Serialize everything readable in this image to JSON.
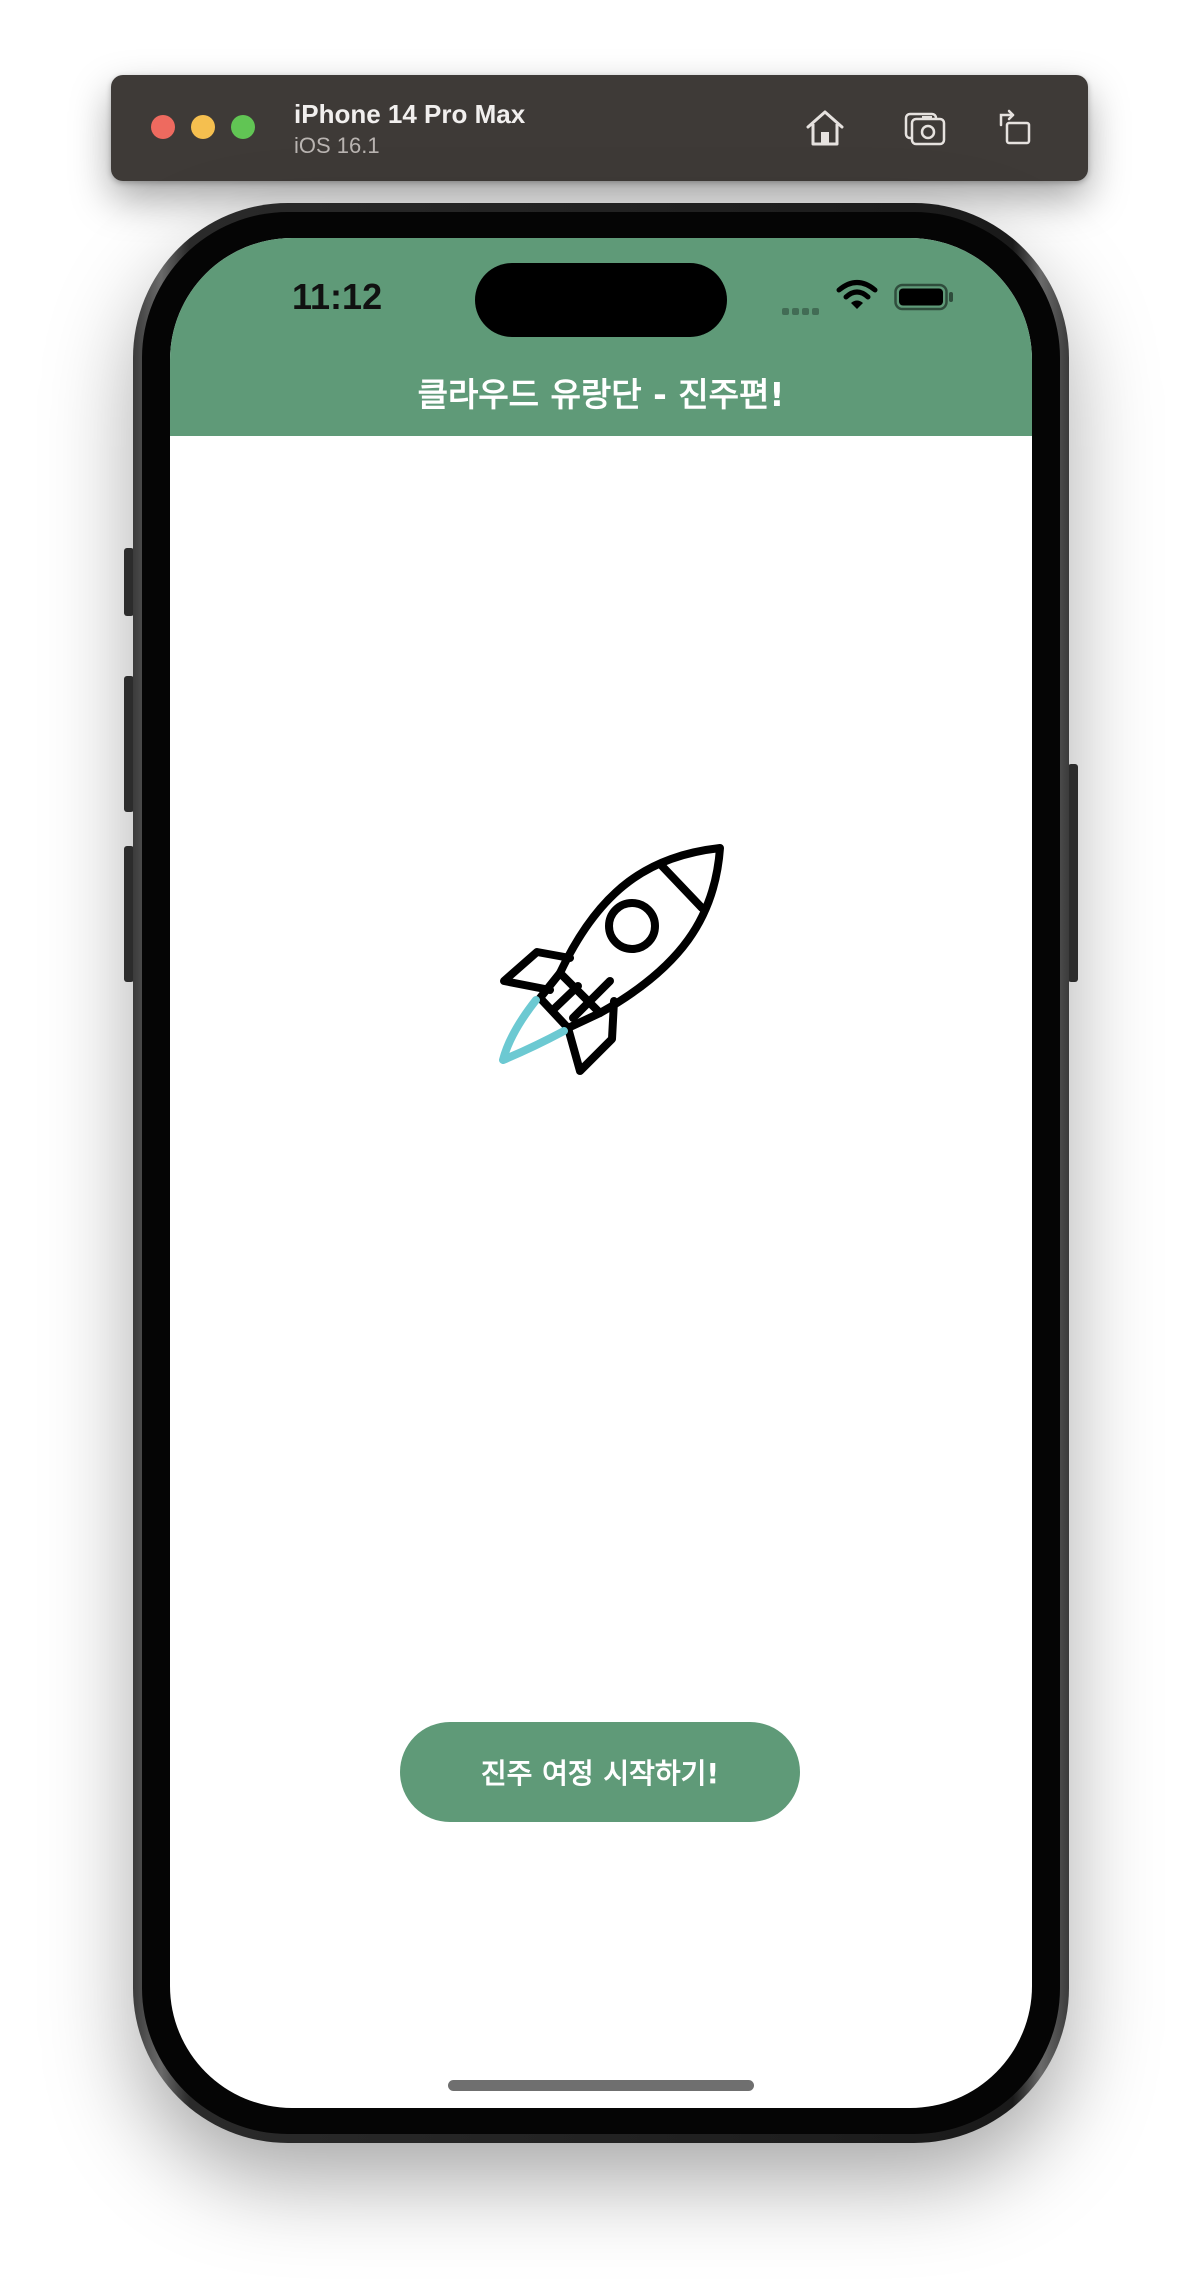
{
  "simulator": {
    "device_name": "iPhone 14 Pro Max",
    "os_version": "iOS 16.1",
    "icons": [
      "home-icon",
      "screenshot-icon",
      "rotate-icon"
    ]
  },
  "status_bar": {
    "time": "11:12"
  },
  "header": {
    "title": "클라우드 유랑단 - 진주편!",
    "color": "#5f9a78"
  },
  "main": {
    "illustration": "rocket-icon",
    "start_button_label": "진주 여정 시작하기!"
  },
  "colors": {
    "accent": "#5f9a78",
    "rocket_flame": "#6cc9d2"
  }
}
